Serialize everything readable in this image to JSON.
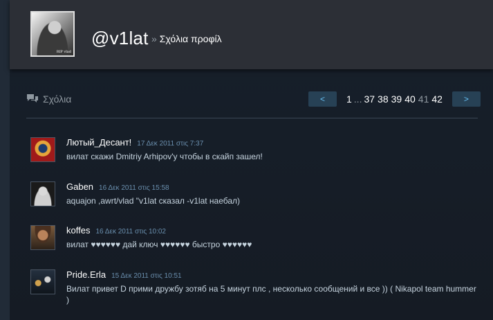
{
  "header": {
    "persona_name": "@v1lat",
    "breadcrumb_sep": "»",
    "breadcrumb_label": "Σχόλια προφίλ",
    "avatar_watermark": "RIP vlad"
  },
  "comments_section": {
    "title": "Σχόλια"
  },
  "pager": {
    "prev_label": "<",
    "next_label": ">",
    "pages": [
      "1",
      "...",
      "37",
      "38",
      "39",
      "40",
      "41",
      "42"
    ],
    "current_page": "41"
  },
  "comments": [
    {
      "author": "Лютый_Десант!",
      "time": "17 Δεκ 2011 στις 7:37",
      "text": "вилат скажи Dmitriy Arhipov'y чтобы в скайп зашел!"
    },
    {
      "author": "Gaben",
      "time": "16 Δεκ 2011 στις 15:58",
      "text": "aquajon ,awrt/vlad \"v1lat сказал -v1lat наебал)"
    },
    {
      "author": "koffes",
      "time": "16 Δεκ 2011 στις 10:02",
      "text": "вилат ♥♥♥♥♥♥ дай ключ ♥♥♥♥♥♥ быстро ♥♥♥♥♥♥"
    },
    {
      "author": "Pride.Erla",
      "time": "15 Δεκ 2011 στις 10:51",
      "text": "Вилат привет D прими дружбу зотяб на 5 минут плс , несколько сообщений и все )) ( Nikapol team hummer )"
    }
  ],
  "colors": {
    "background": "#1b2838",
    "header": "#2c2f36",
    "link": "#66c0f4",
    "timestamp": "#6a8fae",
    "text": "#c6d4df",
    "pager_button": "#274155"
  }
}
